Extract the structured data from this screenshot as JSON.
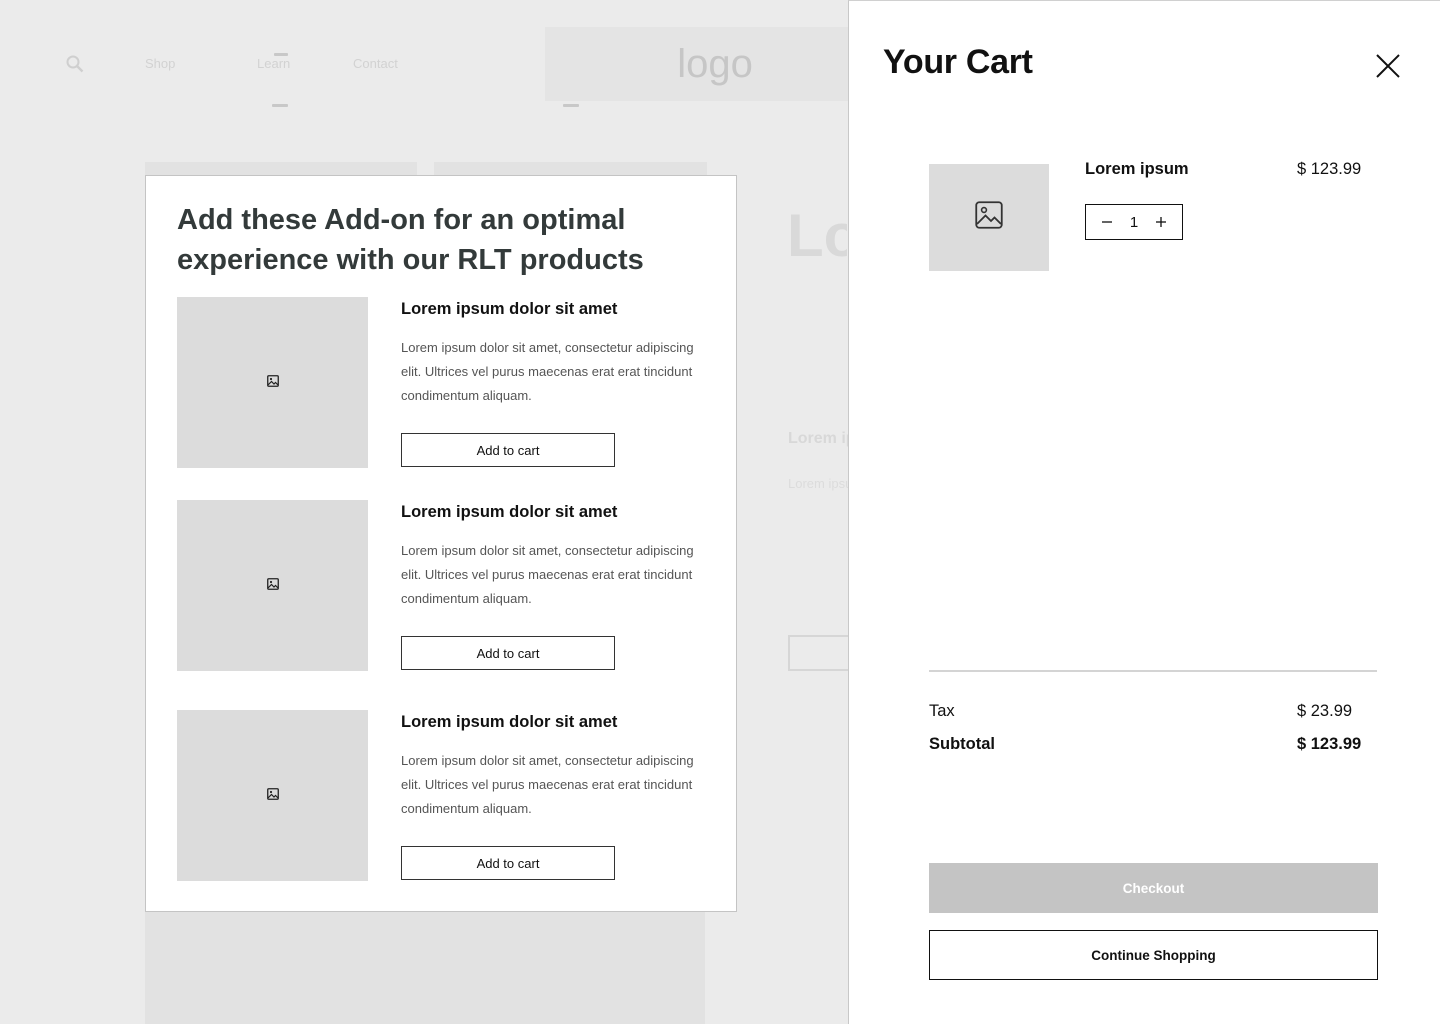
{
  "background": {
    "nav": {
      "shop_label": "Shop",
      "learn_label": "Learn",
      "contact_label": "Contact"
    },
    "logo_text": "logo",
    "hero_title": "Lo sit co",
    "hero_subtitle": "Lorem ip",
    "hero_body": "Lorem ipsum Ultrices vel condiment gravida. U vehicula t"
  },
  "addon_modal": {
    "title": "Add these Add-on for an optimal experience with our RLT products",
    "items": [
      {
        "name": "Lorem ipsum dolor sit amet",
        "description": "Lorem ipsum dolor sit amet, consectetur adipiscing elit. Ultrices vel purus maecenas erat erat tincidunt condimentum aliquam.",
        "button_label": "Add to cart"
      },
      {
        "name": "Lorem ipsum dolor sit amet",
        "description": "Lorem ipsum dolor sit amet, consectetur adipiscing elit. Ultrices vel purus maecenas erat erat tincidunt condimentum aliquam.",
        "button_label": "Add to cart"
      },
      {
        "name": "Lorem ipsum dolor sit amet",
        "description": "Lorem ipsum dolor sit amet, consectetur adipiscing elit. Ultrices vel purus maecenas erat erat tincidunt condimentum aliquam.",
        "button_label": "Add to cart"
      }
    ]
  },
  "cart": {
    "title": "Your Cart",
    "item": {
      "name": "Lorem ipsum",
      "price": "$ 123.99",
      "quantity": "1"
    },
    "tax_label": "Tax",
    "tax_value": "$ 23.99",
    "subtotal_label": "Subtotal",
    "subtotal_value": "$ 123.99",
    "checkout_label": "Checkout",
    "continue_label": "Continue Shopping"
  },
  "icons": {
    "search": "search-icon",
    "image": "image-placeholder-icon",
    "close": "close-icon",
    "minus": "minus-icon",
    "plus": "plus-icon"
  },
  "colors": {
    "overlay_bg": "#ebebeb",
    "checkout_disabled": "#c4c4c4",
    "placeholder": "#dcdcdc",
    "heading": "#333a3a"
  }
}
